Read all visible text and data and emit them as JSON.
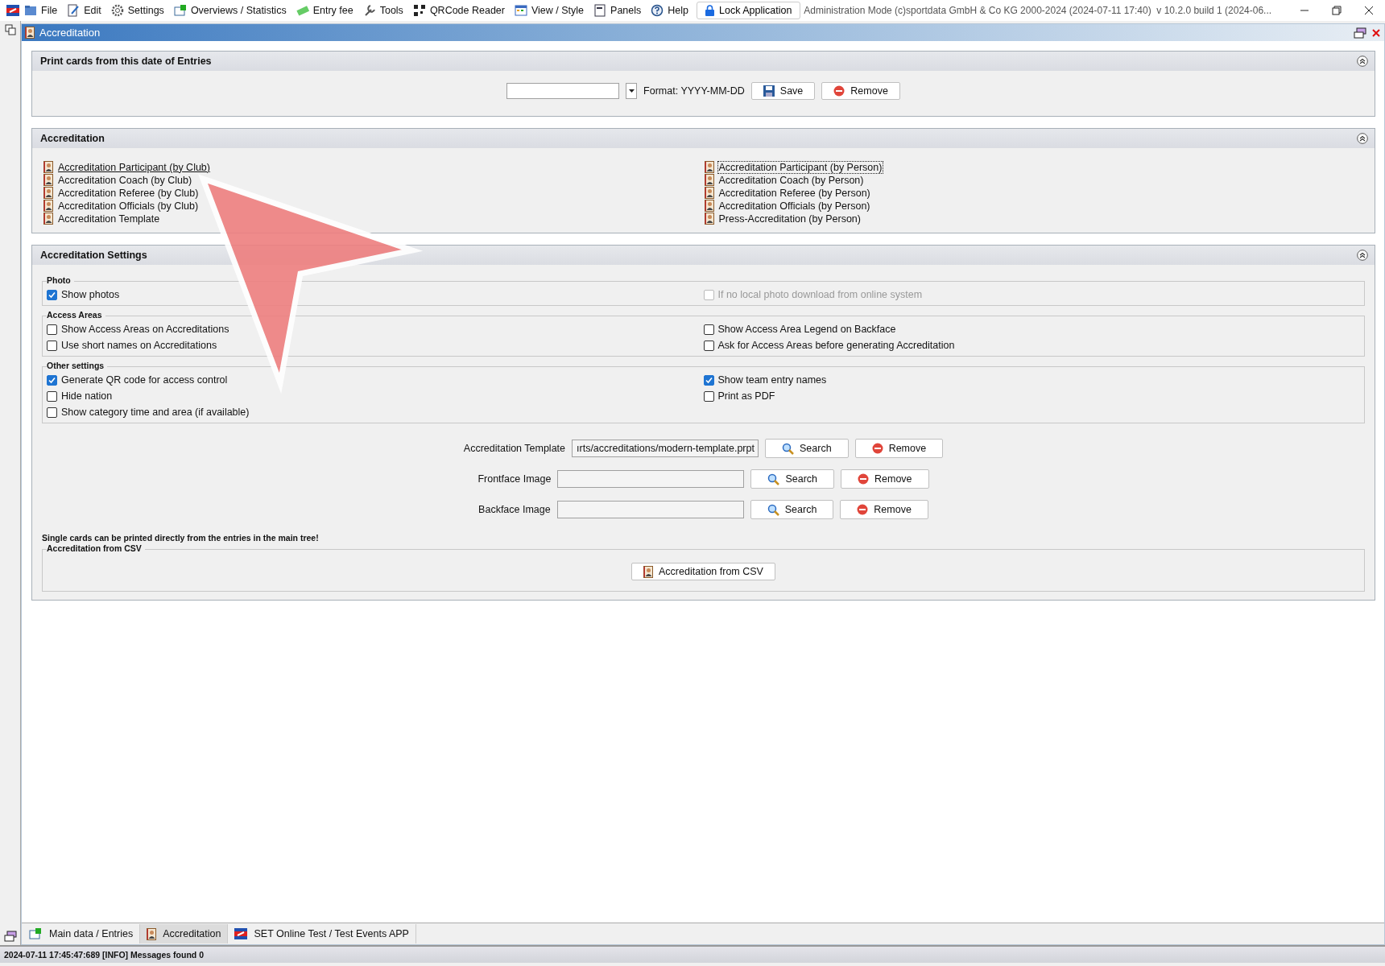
{
  "menu": [
    {
      "label": "File"
    },
    {
      "label": "Edit"
    },
    {
      "label": "Settings"
    },
    {
      "label": "Overviews / Statistics"
    },
    {
      "label": "Entry fee"
    },
    {
      "label": "Tools"
    },
    {
      "label": "QRCode Reader"
    },
    {
      "label": "View / Style"
    },
    {
      "label": "Panels"
    },
    {
      "label": "Help"
    }
  ],
  "lock_button": "Lock Application",
  "app_info": "Administration Mode (c)sportdata GmbH & Co KG 2000-2024 (2024-07-11 17:40)  v 10.2.0 build 1 (2024-06...",
  "window": {
    "title": "Accreditation"
  },
  "print_panel": {
    "title": "Print cards from this date of Entries",
    "format_label": "Format: YYYY-MM-DD",
    "save": "Save",
    "remove": "Remove"
  },
  "accreditation_panel": {
    "title": "Accreditation",
    "columns": [
      [
        {
          "label": "Accreditation Participant (by Club)",
          "hovered": true,
          "focused": false
        },
        {
          "label": "Accreditation Coach (by Club)",
          "hovered": false,
          "focused": false
        },
        {
          "label": "Accreditation Referee (by Club)",
          "hovered": false,
          "focused": false
        },
        {
          "label": "Accreditation Officials (by Club)",
          "hovered": false,
          "focused": false
        },
        {
          "label": "Accreditation Template",
          "hovered": false,
          "focused": false
        }
      ],
      [
        {
          "label": "Accreditation Participant (by Person)",
          "hovered": false,
          "focused": true
        },
        {
          "label": "Accreditation Coach (by Person)",
          "hovered": false,
          "focused": false
        },
        {
          "label": "Accreditation Referee (by Person)",
          "hovered": false,
          "focused": false
        },
        {
          "label": "Accreditation Officials (by Person)",
          "hovered": false,
          "focused": false
        },
        {
          "label": "Press-Accreditation (by Person)",
          "hovered": false,
          "focused": false
        }
      ]
    ]
  },
  "settings_panel": {
    "title": "Accreditation Settings",
    "groups": [
      {
        "title": "Photo",
        "columns": [
          [
            {
              "label": "Show photos",
              "checked": true,
              "disabled": false
            }
          ],
          [
            {
              "label": "If no local photo download from online system",
              "checked": false,
              "disabled": true
            }
          ]
        ]
      },
      {
        "title": "Access Areas",
        "columns": [
          [
            {
              "label": "Show Access Areas on Accreditations",
              "checked": false,
              "disabled": false
            },
            {
              "label": "Use short names on Accreditations",
              "checked": false,
              "disabled": false
            }
          ],
          [
            {
              "label": "Show Access Area Legend on Backface",
              "checked": false,
              "disabled": false
            },
            {
              "label": "Ask for Access Areas before generating Accreditation",
              "checked": false,
              "disabled": false
            }
          ]
        ]
      },
      {
        "title": "Other settings",
        "columns": [
          [
            {
              "label": "Generate QR code for access control",
              "checked": true,
              "disabled": false
            },
            {
              "label": "Hide nation",
              "checked": false,
              "disabled": false
            },
            {
              "label": "Show category time and area (if available)",
              "checked": false,
              "disabled": false
            }
          ],
          [
            {
              "label": "Show team entry names",
              "checked": true,
              "disabled": false
            },
            {
              "label": "Print as PDF",
              "checked": false,
              "disabled": false
            }
          ]
        ]
      }
    ],
    "file_rows": [
      {
        "label": "Accreditation Template",
        "value": "ırts/accreditations/modern-template.prpt",
        "search": "Search",
        "remove": "Remove"
      },
      {
        "label": "Frontface Image",
        "search": "Search",
        "remove": "Remove"
      },
      {
        "label": "Backface Image",
        "search": "Search",
        "remove": "Remove"
      }
    ],
    "hint": "Single cards can be printed directly from the entries in the main tree!",
    "csv_group": {
      "title": "Accreditation from CSV",
      "button": "Accreditation from CSV"
    }
  },
  "bottom_tabs": [
    {
      "label": "Main data / Entries",
      "selected": false
    },
    {
      "label": "Accreditation",
      "selected": true
    },
    {
      "label": "SET Online Test / Test Events APP",
      "selected": false
    }
  ],
  "status_bar": "2024-07-11 17:45:47:689 [INFO] Messages found 0"
}
